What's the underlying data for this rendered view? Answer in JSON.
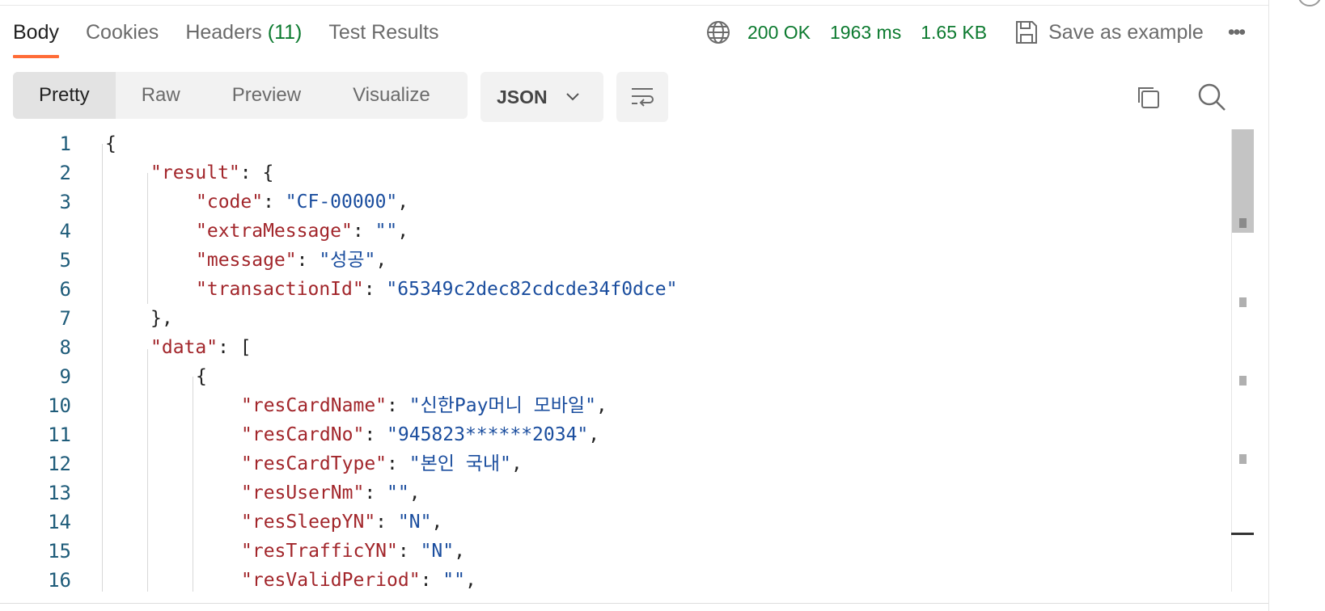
{
  "tabs": [
    {
      "label": "Body"
    },
    {
      "label": "Cookies"
    },
    {
      "label": "Headers",
      "count": "(11)"
    },
    {
      "label": "Test Results"
    }
  ],
  "status": {
    "code": "200 OK",
    "time": "1963 ms",
    "size": "1.65 KB",
    "save_label": "Save as example",
    "more": "•••"
  },
  "view_modes": [
    "Pretty",
    "Raw",
    "Preview",
    "Visualize"
  ],
  "format": "JSON",
  "code_lines": [
    {
      "n": "1",
      "depth": 0,
      "parts": [
        [
          "p",
          "{"
        ]
      ]
    },
    {
      "n": "2",
      "depth": 1,
      "parts": [
        [
          "k",
          "\"result\""
        ],
        [
          "p",
          ": {"
        ]
      ]
    },
    {
      "n": "3",
      "depth": 2,
      "parts": [
        [
          "k",
          "\"code\""
        ],
        [
          "p",
          ": "
        ],
        [
          "s",
          "\"CF-00000\""
        ],
        [
          "p",
          ","
        ]
      ]
    },
    {
      "n": "4",
      "depth": 2,
      "parts": [
        [
          "k",
          "\"extraMessage\""
        ],
        [
          "p",
          ": "
        ],
        [
          "s",
          "\"\""
        ],
        [
          "p",
          ","
        ]
      ]
    },
    {
      "n": "5",
      "depth": 2,
      "parts": [
        [
          "k",
          "\"message\""
        ],
        [
          "p",
          ": "
        ],
        [
          "s",
          "\"성공\""
        ],
        [
          "p",
          ","
        ]
      ]
    },
    {
      "n": "6",
      "depth": 2,
      "parts": [
        [
          "k",
          "\"transactionId\""
        ],
        [
          "p",
          ": "
        ],
        [
          "s",
          "\"65349c2dec82cdcde34f0dce\""
        ]
      ]
    },
    {
      "n": "7",
      "depth": 1,
      "parts": [
        [
          "p",
          "},"
        ]
      ]
    },
    {
      "n": "8",
      "depth": 1,
      "parts": [
        [
          "k",
          "\"data\""
        ],
        [
          "p",
          ": ["
        ]
      ]
    },
    {
      "n": "9",
      "depth": 2,
      "parts": [
        [
          "p",
          "{"
        ]
      ]
    },
    {
      "n": "10",
      "depth": 3,
      "parts": [
        [
          "k",
          "\"resCardName\""
        ],
        [
          "p",
          ": "
        ],
        [
          "s",
          "\"신한Pay머니 모바일\""
        ],
        [
          "p",
          ","
        ]
      ]
    },
    {
      "n": "11",
      "depth": 3,
      "parts": [
        [
          "k",
          "\"resCardNo\""
        ],
        [
          "p",
          ": "
        ],
        [
          "s",
          "\"945823******2034\""
        ],
        [
          "p",
          ","
        ]
      ]
    },
    {
      "n": "12",
      "depth": 3,
      "parts": [
        [
          "k",
          "\"resCardType\""
        ],
        [
          "p",
          ": "
        ],
        [
          "s",
          "\"본인 국내\""
        ],
        [
          "p",
          ","
        ]
      ]
    },
    {
      "n": "13",
      "depth": 3,
      "parts": [
        [
          "k",
          "\"resUserNm\""
        ],
        [
          "p",
          ": "
        ],
        [
          "s",
          "\"\""
        ],
        [
          "p",
          ","
        ]
      ]
    },
    {
      "n": "14",
      "depth": 3,
      "parts": [
        [
          "k",
          "\"resSleepYN\""
        ],
        [
          "p",
          ": "
        ],
        [
          "s",
          "\"N\""
        ],
        [
          "p",
          ","
        ]
      ]
    },
    {
      "n": "15",
      "depth": 3,
      "parts": [
        [
          "k",
          "\"resTrafficYN\""
        ],
        [
          "p",
          ": "
        ],
        [
          "s",
          "\"N\""
        ],
        [
          "p",
          ","
        ]
      ]
    },
    {
      "n": "16",
      "depth": 3,
      "parts": [
        [
          "k",
          "\"resValidPeriod\""
        ],
        [
          "p",
          ": "
        ],
        [
          "s",
          "\"\""
        ],
        [
          "p",
          ","
        ]
      ]
    }
  ],
  "colors": {
    "accent": "#ff6c37",
    "success": "#0c7a2f",
    "key": "#a2262b",
    "string": "#1a4d9e"
  }
}
